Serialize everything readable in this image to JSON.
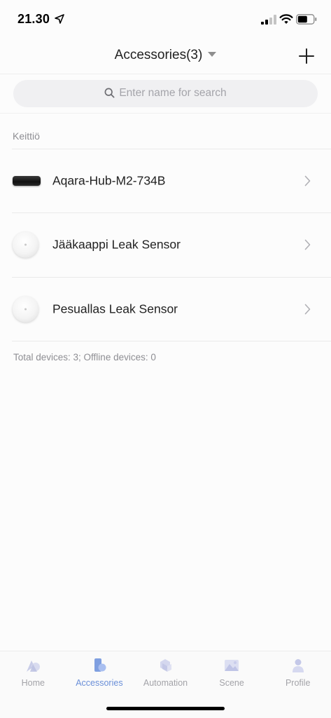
{
  "status_bar": {
    "time": "21.30",
    "location_icon": "location-arrow-icon",
    "signal_icon": "cellular-signal-icon",
    "wifi_icon": "wifi-icon",
    "battery_icon": "battery-icon"
  },
  "nav": {
    "title": "Accessories(3)",
    "dropdown_icon": "caret-down-icon",
    "add_icon": "plus-icon"
  },
  "search": {
    "placeholder": "Enter name for search",
    "icon": "search-icon"
  },
  "section": {
    "label": "Keittiö"
  },
  "devices": [
    {
      "name": "Aqara-Hub-M2-734B",
      "icon": "hub-icon"
    },
    {
      "name": "Jääkaappi Leak Sensor",
      "icon": "leak-sensor-icon"
    },
    {
      "name": "Pesuallas Leak Sensor",
      "icon": "leak-sensor-icon"
    }
  ],
  "summary": "Total devices: 3; Offline devices: 0",
  "tabs": [
    {
      "label": "Home",
      "icon": "home-icon",
      "active": false
    },
    {
      "label": "Accessories",
      "icon": "accessories-icon",
      "active": true
    },
    {
      "label": "Automation",
      "icon": "automation-icon",
      "active": false
    },
    {
      "label": "Scene",
      "icon": "scene-icon",
      "active": false
    },
    {
      "label": "Profile",
      "icon": "profile-icon",
      "active": false
    }
  ],
  "colors": {
    "accent": "#6a8fd8",
    "inactive_tab": "#a3a3a8",
    "background": "#fcfcfc",
    "search_bg": "#f0f0f2"
  }
}
